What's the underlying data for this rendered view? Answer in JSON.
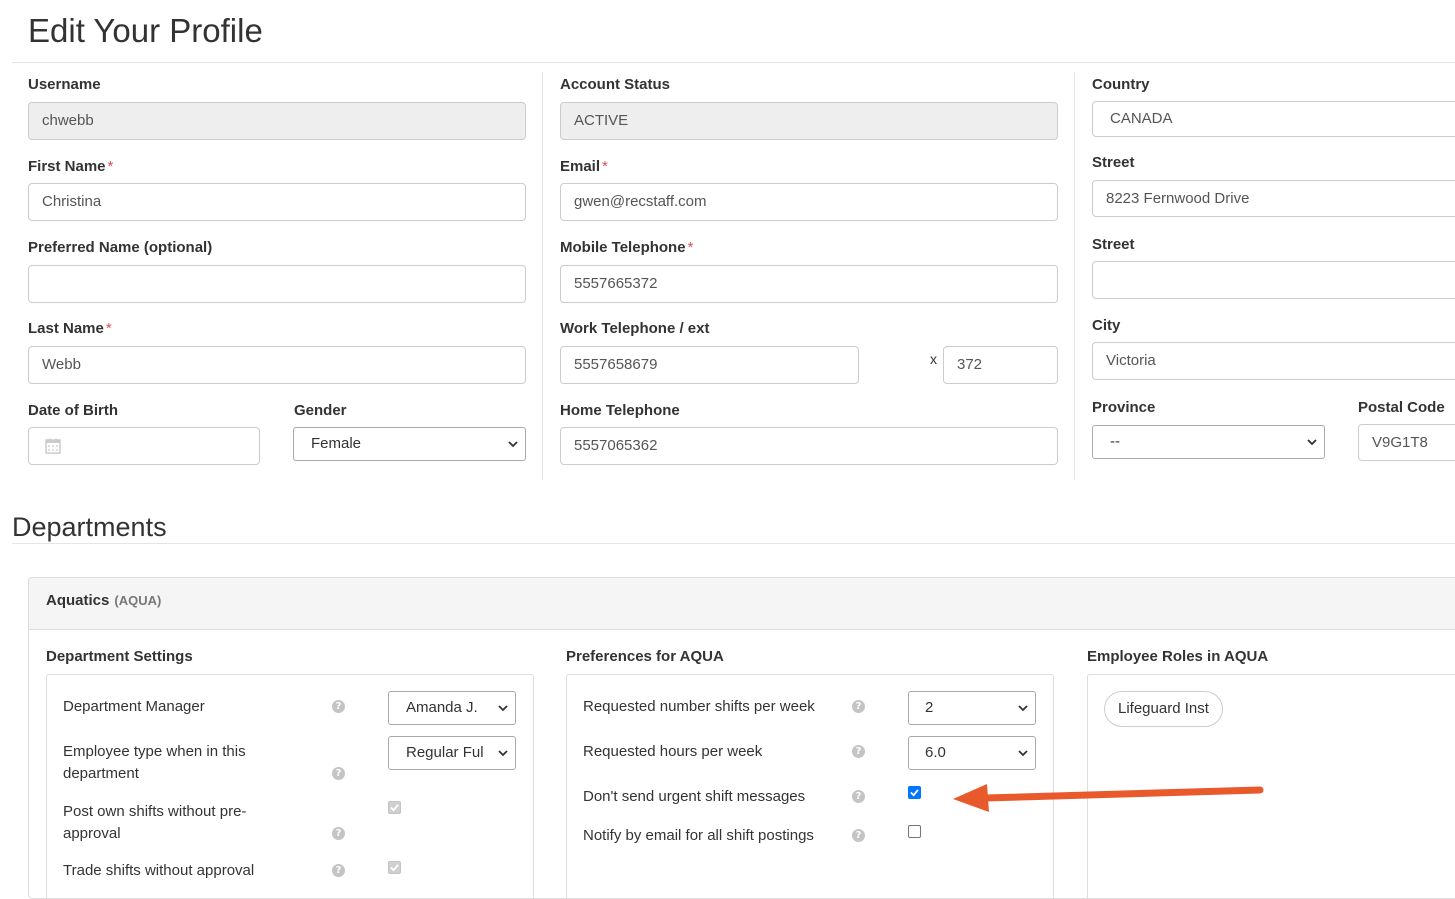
{
  "page_title": "Edit Your Profile",
  "col1": {
    "username": {
      "label": "Username",
      "value": "chwebb"
    },
    "first_name": {
      "label": "First Name",
      "value": "Christina"
    },
    "preferred_name": {
      "label": "Preferred Name (optional)",
      "value": ""
    },
    "last_name": {
      "label": "Last Name",
      "value": "Webb"
    },
    "dob": {
      "label": "Date of Birth",
      "value": ""
    },
    "gender": {
      "label": "Gender",
      "value": "Female"
    }
  },
  "col2": {
    "account_status": {
      "label": "Account Status",
      "value": "ACTIVE"
    },
    "email": {
      "label": "Email",
      "value": "gwen@recstaff.com"
    },
    "mobile": {
      "label": "Mobile Telephone",
      "value": "5557665372"
    },
    "work": {
      "label": "Work Telephone / ext",
      "value": "5557658679",
      "ext_label": "x",
      "ext": "372"
    },
    "home": {
      "label": "Home Telephone",
      "value": "5557065362"
    }
  },
  "col3": {
    "country": {
      "label": "Country",
      "value": "CANADA"
    },
    "street1": {
      "label": "Street",
      "value": "8223 Fernwood Drive"
    },
    "street2": {
      "label": "Street",
      "value": ""
    },
    "city": {
      "label": "City",
      "value": "Victoria"
    },
    "province": {
      "label": "Province",
      "value": "--"
    },
    "postal": {
      "label": "Postal Code",
      "value": "V9G1T8"
    }
  },
  "departments": {
    "heading": "Departments",
    "dept": {
      "name": "Aquatics",
      "code": "(AQUA)"
    },
    "settings": {
      "heading": "Department Settings",
      "manager_label": "Department Manager",
      "manager_value": "Amanda J.",
      "emptype_label": "Employee type when in this department",
      "emptype_value": "Regular Ful",
      "post_label": "Post own shifts without pre-approval",
      "post_checked": true,
      "trade_label": "Trade shifts without approval",
      "trade_checked": true
    },
    "prefs": {
      "heading": "Preferences for AQUA",
      "shifts_label": "Requested number shifts per week",
      "shifts_value": "2",
      "hours_label": "Requested hours per week",
      "hours_value": "6.0",
      "urgent_label": "Don't send urgent shift messages",
      "urgent_checked": true,
      "notify_label": "Notify by email for all shift postings",
      "notify_checked": false
    },
    "roles": {
      "heading": "Employee Roles in AQUA",
      "items": [
        "Lifeguard Inst"
      ]
    }
  },
  "help_glyph": "?",
  "colors": {
    "annotation_arrow": "#e8592c",
    "required": "#d9534f",
    "checkbox": "#0075ff"
  }
}
